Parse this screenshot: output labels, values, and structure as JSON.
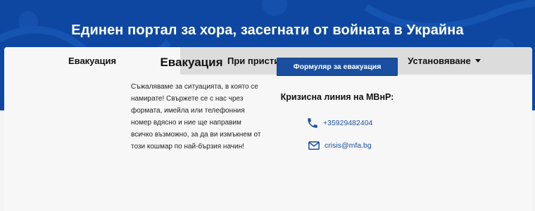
{
  "hero": {
    "title": "Единен портал за хора, засегнати от войната в Украйна"
  },
  "tabs": [
    {
      "label": "Евакуация",
      "active": true,
      "has_dropdown": false
    },
    {
      "label": "При пристигане",
      "active": false,
      "has_dropdown": true
    },
    {
      "label": "Установяване",
      "active": false,
      "has_dropdown": true
    }
  ],
  "evacuation": {
    "title": "Евакуация",
    "text": "Съжаляваме за ситуацията, в която се намирате! Свържете се с нас чрез формата, имейла или телефонния номер вдясно и ние ще направим всичко възможно, за да ви измъкнем от този кошмар по най-бързия начин!"
  },
  "form_button": {
    "label": "Формуляр за евакуация"
  },
  "crisis": {
    "title": "Кризисна линия на МВнР:",
    "phone": "+35929482404",
    "email": "crisis@mfa.bg"
  },
  "colors": {
    "hero_blue": "#0d47a1",
    "accent_blue": "#1a4fa0",
    "tab_inactive": "#dcdcdc"
  },
  "icons": {
    "phone": "phone-icon",
    "email": "envelope-icon",
    "dropdown": "caret-down-icon"
  }
}
